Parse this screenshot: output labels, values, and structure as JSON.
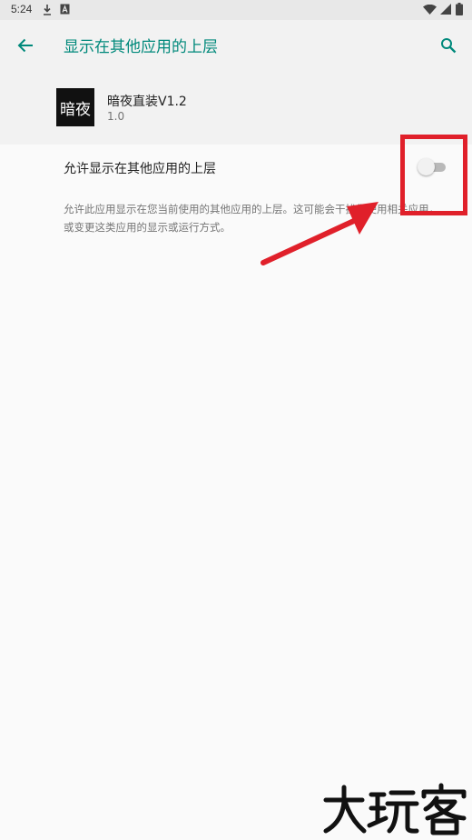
{
  "status_bar": {
    "time": "5:24",
    "icons": [
      "download-icon",
      "a-badge-icon",
      "wifi-icon",
      "signal-icon",
      "battery-icon"
    ]
  },
  "app_bar": {
    "title": "显示在其他应用的上层",
    "back_icon": "arrow-left-icon",
    "search_icon": "search-icon"
  },
  "app_info": {
    "icon_text": "暗夜",
    "name": "暗夜直装V1.2",
    "version": "1.0"
  },
  "setting": {
    "label": "允许显示在其他应用的上层",
    "enabled": false,
    "description": "允许此应用显示在您当前使用的其他应用的上层。这可能会干扰您使用相关应用，或变更这类应用的显示或运行方式。"
  },
  "colors": {
    "accent": "#00897b",
    "annotation": "#e0202a"
  },
  "watermark": {
    "text": "大玩客"
  }
}
